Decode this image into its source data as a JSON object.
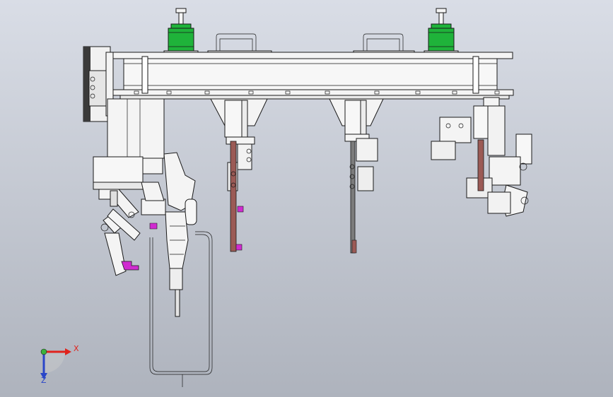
{
  "triad": {
    "x_label": "X",
    "z_label": "Z",
    "colors": {
      "x": "#e0231c",
      "y": "#3cb33c",
      "z": "#2a46c8"
    }
  },
  "colors": {
    "background_top": "#d9dde6",
    "background_bottom": "#aeb3bd",
    "cylinder_green": "#1fb33a",
    "rod_brown": "#9b5a55",
    "accent_magenta": "#d02bd0",
    "part_white": "#f4f4f4",
    "dark_module": "#3a3a3a"
  }
}
